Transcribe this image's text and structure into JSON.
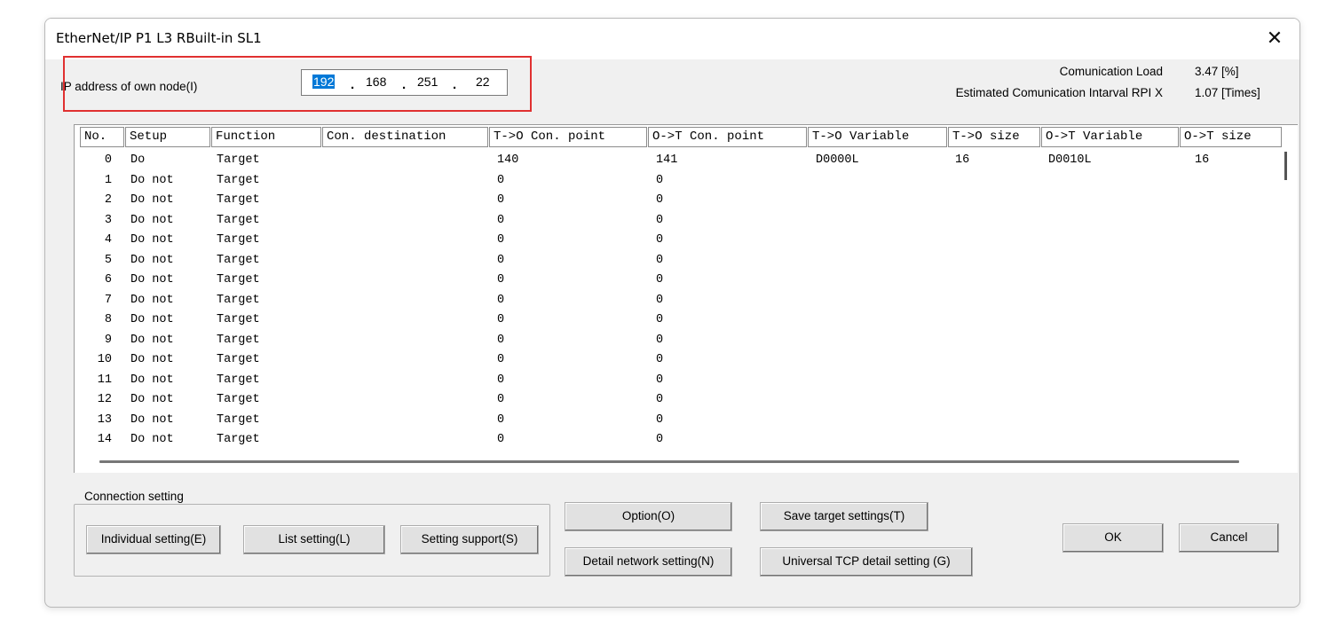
{
  "window": {
    "title": "EtherNet/IP  P1 L3 RBuilt-in SL1",
    "close_glyph": "✕"
  },
  "ip": {
    "label": "IP address of own node(I)",
    "octets": [
      "192",
      "168",
      "251",
      "22"
    ],
    "separator": "."
  },
  "stats": {
    "load_label": "Comunication Load",
    "load_value": "3.47 [%]",
    "rpi_label": "Estimated Comunication Intarval RPI X",
    "rpi_value": "1.07 [Times]"
  },
  "table": {
    "columns": [
      "No.",
      "Setup",
      "Function",
      "Con. destination",
      "T->O Con. point",
      "O->T Con. point",
      "T->O Variable",
      "T->O size",
      "O->T Variable",
      "O->T size"
    ],
    "rows": [
      [
        "0",
        "Do",
        "Target",
        "",
        "140",
        "141",
        "D0000L",
        "16",
        "D0010L",
        "16"
      ],
      [
        "1",
        "Do not",
        "Target",
        "",
        "0",
        "0",
        "",
        "",
        "",
        ""
      ],
      [
        "2",
        "Do not",
        "Target",
        "",
        "0",
        "0",
        "",
        "",
        "",
        ""
      ],
      [
        "3",
        "Do not",
        "Target",
        "",
        "0",
        "0",
        "",
        "",
        "",
        ""
      ],
      [
        "4",
        "Do not",
        "Target",
        "",
        "0",
        "0",
        "",
        "",
        "",
        ""
      ],
      [
        "5",
        "Do not",
        "Target",
        "",
        "0",
        "0",
        "",
        "",
        "",
        ""
      ],
      [
        "6",
        "Do not",
        "Target",
        "",
        "0",
        "0",
        "",
        "",
        "",
        ""
      ],
      [
        "7",
        "Do not",
        "Target",
        "",
        "0",
        "0",
        "",
        "",
        "",
        ""
      ],
      [
        "8",
        "Do not",
        "Target",
        "",
        "0",
        "0",
        "",
        "",
        "",
        ""
      ],
      [
        "9",
        "Do not",
        "Target",
        "",
        "0",
        "0",
        "",
        "",
        "",
        ""
      ],
      [
        "10",
        "Do not",
        "Target",
        "",
        "0",
        "0",
        "",
        "",
        "",
        ""
      ],
      [
        "11",
        "Do not",
        "Target",
        "",
        "0",
        "0",
        "",
        "",
        "",
        ""
      ],
      [
        "12",
        "Do not",
        "Target",
        "",
        "0",
        "0",
        "",
        "",
        "",
        ""
      ],
      [
        "13",
        "Do not",
        "Target",
        "",
        "0",
        "0",
        "",
        "",
        "",
        ""
      ],
      [
        "14",
        "Do not",
        "Target",
        "",
        "0",
        "0",
        "",
        "",
        "",
        ""
      ]
    ]
  },
  "connection_setting": {
    "title": "Connection setting",
    "individual": "Individual setting(E)",
    "list": "List setting(L)",
    "support": "Setting support(S)"
  },
  "buttons": {
    "option": "Option(O)",
    "detail_network": "Detail network setting(N)",
    "save_target": "Save target settings(T)",
    "universal_tcp": "Universal TCP detail setting (G)",
    "ok": "OK",
    "cancel": "Cancel"
  },
  "colors": {
    "selection": "#0078d7",
    "highlight_box": "#e03030",
    "dialog_bg": "#f0f0f0"
  }
}
